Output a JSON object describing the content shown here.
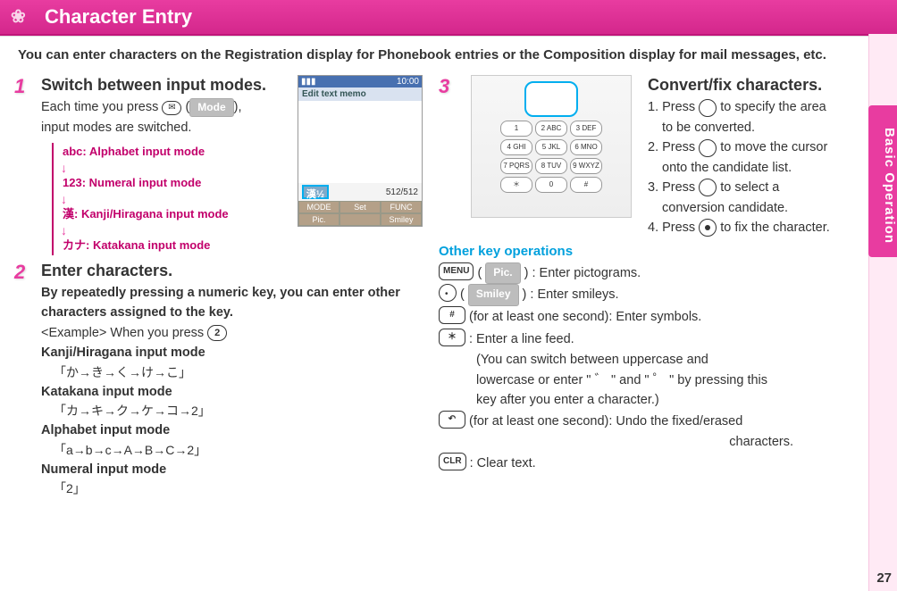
{
  "header": {
    "title": "Character Entry",
    "flower_icon": "❀"
  },
  "sidebar": {
    "tab_label": "Basic Operation",
    "page_number": "27"
  },
  "intro": "You can enter characters on the Registration display for Phonebook entries or the Composition display for mail messages, etc.",
  "step1": {
    "num": "1",
    "title": "Switch between input modes.",
    "line1_a": "Each time you press ",
    "line1_mail_glyph": "✉",
    "line1_b": "(",
    "mode_label": "Mode",
    "line1_c": "),",
    "line2": "input modes are switched.",
    "modes": {
      "abc": "abc: Alphabet input mode",
      "num": "123: Numeral input mode",
      "kanji": "漢: Kanji/Hiragana input mode",
      "kata": "カナ: Katakana input mode"
    },
    "phone": {
      "clock": "10:00",
      "title": "Edit text memo",
      "indicator": "漢½",
      "counter": "512/512",
      "sk1": "MODE",
      "sk2": "Set",
      "sk3": "FUNC",
      "sk4": "Pic.",
      "sk5": "",
      "sk6": "Smiley"
    }
  },
  "step2": {
    "num": "2",
    "title": "Enter characters.",
    "bold_intro": "By repeatedly pressing a numeric key, you can enter other characters assigned to the key.",
    "example_prefix": "<Example> When you press ",
    "example_key": "2",
    "kanji_label": "Kanji/Hiragana input mode",
    "kanji_seq": "「か→き→く→け→こ」",
    "kata_label": "Katakana input mode",
    "kata_seq": "「カ→キ→ク→ケ→コ→2」",
    "alpha_label": "Alphabet input mode",
    "alpha_seq": "「a→b→c→A→B→C→2」",
    "num_label": "Numeral input mode",
    "num_seq": "「2」"
  },
  "step3": {
    "num": "3",
    "title": "Convert/fix characters.",
    "l1a": "1. Press ",
    "l1b": " to specify the area",
    "l1c": "to be converted.",
    "l2a": "2. Press ",
    "l2b": " to move the cursor",
    "l2c": "onto the candidate list.",
    "l3a": "3. Press ",
    "l3b": " to select a",
    "l3c": "conversion candidate.",
    "l4a": "4. Press ",
    "l4b": " to fix the character."
  },
  "other_ops": {
    "heading": "Other key operations",
    "menu_key": "MENU",
    "pic_label": "Pic.",
    "pic_text": ": Enter pictograms.",
    "tv_key": "◯",
    "smiley_label": "Smiley",
    "smiley_text": ": Enter smileys.",
    "hash_key": "#",
    "hash_text": "(for at least one second): Enter symbols.",
    "star_key": "＊",
    "star_text": ": Enter a line feed.",
    "star_sub1": "(You can switch between uppercase and",
    "star_sub2": "lowercase or enter \" ゛ \" and \" ゜ \" by pressing this",
    "star_sub3": "key after you enter a character.)",
    "clr_pre_key": "↶",
    "clr_pre_text": "(for at least one second): Undo the fixed/erased",
    "clr_pre_sub": "characters.",
    "clr_key": "CLR",
    "clr_text": ": Clear text."
  }
}
